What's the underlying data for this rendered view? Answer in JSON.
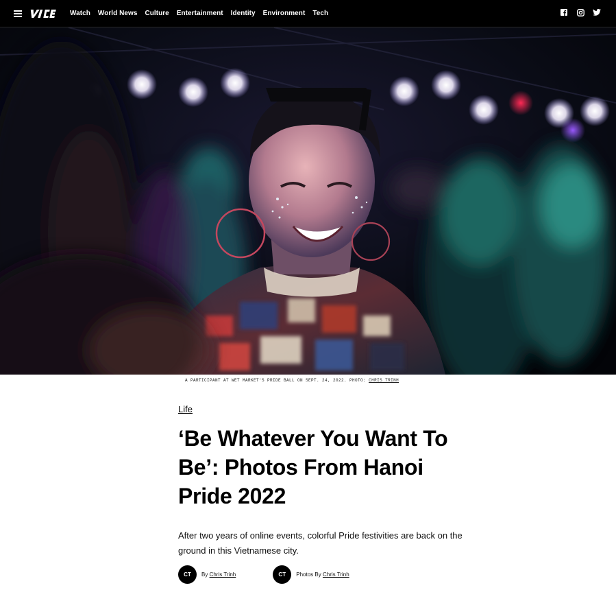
{
  "header": {
    "brand": "VICE",
    "nav": [
      "Watch",
      "World News",
      "Culture",
      "Entertainment",
      "Identity",
      "Environment",
      "Tech"
    ],
    "social_icons": [
      "facebook-icon",
      "instagram-icon",
      "twitter-icon"
    ],
    "background": "#000000"
  },
  "hero": {
    "caption_prefix": "A participant at Wet Market's Pride Ball on Sept. 24, 2022. Photo:",
    "caption_credit": "Chris Trinh"
  },
  "article": {
    "section": "Life",
    "headline": "‘Be Whatever You Want To Be’: Photos From Hanoi Pride 2022",
    "dek": "After two years of online events, colorful Pride festivities are back on the ground in this Vietnamese city.",
    "bylines": [
      {
        "initials": "CT",
        "prefix": "By",
        "name": "Chris Trinh"
      },
      {
        "initials": "CT",
        "prefix": "Photos By",
        "name": "Chris Trinh"
      }
    ]
  }
}
